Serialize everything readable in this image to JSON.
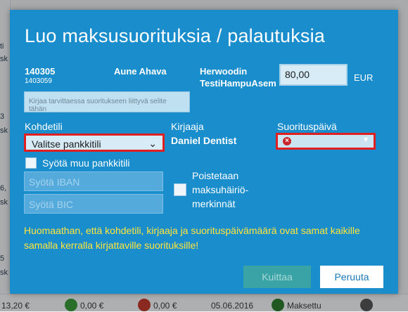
{
  "background": {
    "left_fragments": [
      "ti",
      "sk",
      "3",
      "sk",
      "6,",
      "sk",
      "5",
      "sk"
    ],
    "bottom_items": [
      "13,20 €",
      "0,00 €",
      "0,00 €",
      "05.06.2016",
      "Maksettu"
    ]
  },
  "dialog": {
    "title": "Luo maksusuorituksia / palautuksia",
    "invoice": {
      "number": "140305",
      "reference": "1403059"
    },
    "payer_name": "Aune Ahava",
    "target_name_line1": "Herwoodin",
    "target_name_line2": "TestiHampuAsem",
    "amount": {
      "value": "80,00",
      "currency": "EUR"
    },
    "note_placeholder": "Kirjaa tarvittaessa suoritukseen liittyvä selite tähän",
    "account": {
      "label": "Kohdetili",
      "selected": "Valitse pankkitili"
    },
    "recorder": {
      "label": "Kirjaaja",
      "value": "Daniel Dentist"
    },
    "payment_date": {
      "label": "Suorituspäivä",
      "value": ""
    },
    "other_account": {
      "label": "Syötä muu pankkitili",
      "checked": false
    },
    "iban_placeholder": "Syötä IBAN",
    "bic_placeholder": "Syötä BIC",
    "remove_disturbance": {
      "line1": "Poistetaan",
      "line2": "maksuhäiriö-",
      "line3": "merkinnät",
      "checked": false
    },
    "notice": "Huomaathan, että kohdetili, kirjaaja ja suorituspäivämäärä ovat samat kaikille samalla kerralla kirjattaville suorituksille!",
    "buttons": {
      "confirm": "Kuittaa",
      "cancel": "Peruuta"
    }
  },
  "colors": {
    "dialog_bg": "#1a8dcc",
    "error_border": "#e02020",
    "notice_text": "#ffe53d",
    "confirm_disabled_bg": "#3aa3a5"
  },
  "icons": [
    "chevron-down-icon",
    "error-icon",
    "date-dropdown-icon",
    "checkbox-icon"
  ]
}
